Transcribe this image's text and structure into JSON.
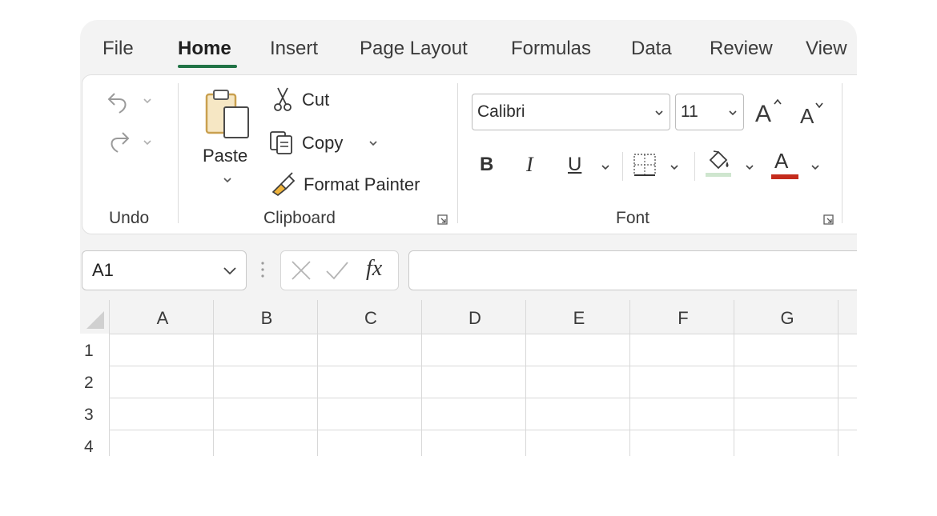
{
  "menu": {
    "tabs": [
      {
        "label": "File"
      },
      {
        "label": "Home"
      },
      {
        "label": "Insert"
      },
      {
        "label": "Page Layout"
      },
      {
        "label": "Formulas"
      },
      {
        "label": "Data"
      },
      {
        "label": "Review"
      },
      {
        "label": "View"
      }
    ],
    "active": "Home"
  },
  "ribbon": {
    "undo": {
      "group_label": "Undo"
    },
    "clipboard": {
      "paste_label": "Paste",
      "cut_label": "Cut",
      "copy_label": "Copy",
      "format_painter_label": "Format Painter",
      "group_label": "Clipboard"
    },
    "font": {
      "font_name": "Calibri",
      "font_size": "11",
      "bold": "B",
      "italic": "I",
      "underline": "U",
      "font_color_glyph": "A",
      "group_label": "Font"
    }
  },
  "formula_bar": {
    "name_box": "A1",
    "fx": "fx",
    "formula": ""
  },
  "grid": {
    "columns": [
      "A",
      "B",
      "C",
      "D",
      "E",
      "F",
      "G"
    ],
    "rows": [
      "1",
      "2",
      "3",
      "4"
    ]
  },
  "colors": {
    "accent": "#217346",
    "font_color_bar": "#c42b1c",
    "paste_icon": "#c9a04f"
  }
}
